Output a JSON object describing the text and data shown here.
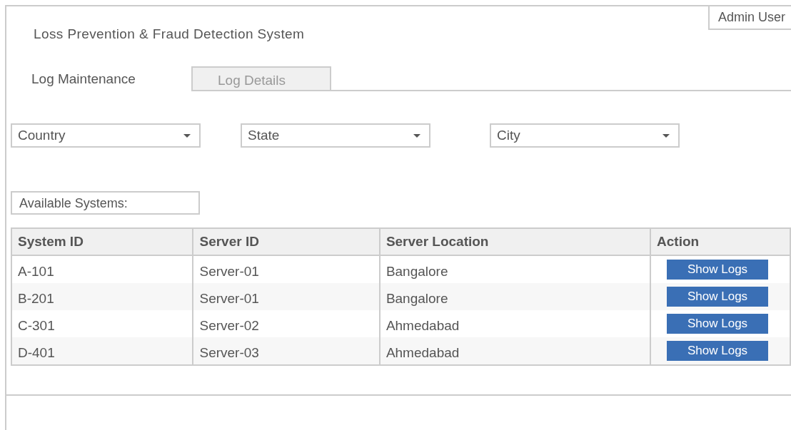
{
  "header": {
    "title": "Loss Prevention & Fraud Detection System",
    "user": "Admin User"
  },
  "tabs": [
    {
      "label": "Log Maintenance",
      "selected": true
    },
    {
      "label": "Log Details",
      "selected": false
    }
  ],
  "filters": [
    {
      "value": "Country"
    },
    {
      "value": "State"
    },
    {
      "value": "City"
    }
  ],
  "section_label": "Available Systems:",
  "table": {
    "columns": [
      "System ID",
      "Server ID",
      "Server Location",
      "Action"
    ],
    "rows": [
      {
        "cells": [
          "A-101",
          "Server-01",
          "Bangalore"
        ],
        "action": "Show Logs"
      },
      {
        "cells": [
          "B-201",
          "Server-01",
          "Bangalore"
        ],
        "action": "Show Logs"
      },
      {
        "cells": [
          "C-301",
          "Server-02",
          "Ahmedabad"
        ],
        "action": "Show Logs"
      },
      {
        "cells": [
          "D-401",
          "Server-03",
          "Ahmedabad"
        ],
        "action": "Show Logs"
      }
    ]
  }
}
